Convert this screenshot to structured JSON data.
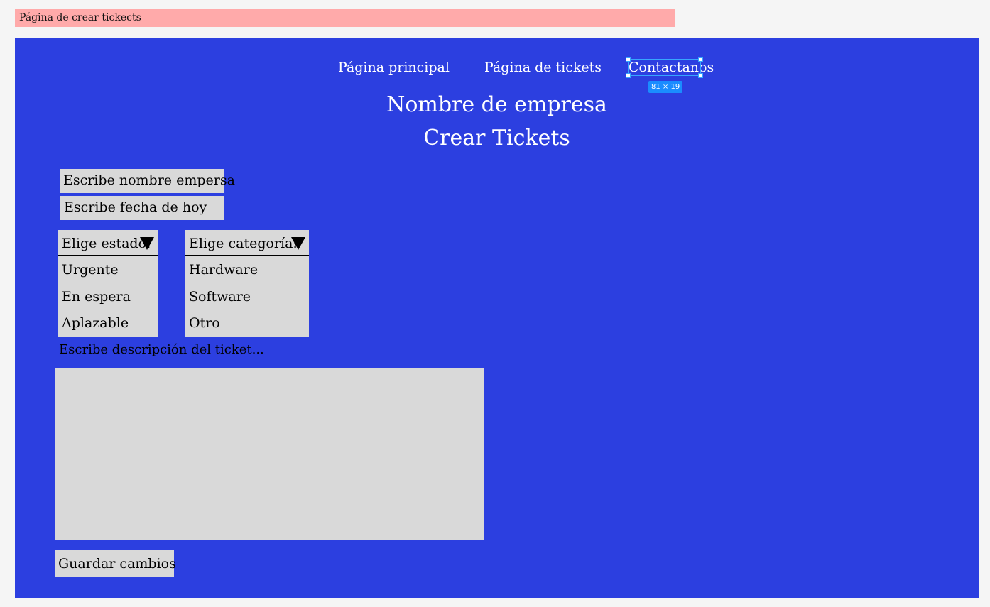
{
  "frame": {
    "label": "Página de crear tickects"
  },
  "nav": {
    "items": [
      {
        "label": "Página principal"
      },
      {
        "label": "Página de tickets"
      },
      {
        "label": "Contactanos"
      }
    ],
    "selection_size": "81 × 19"
  },
  "header": {
    "company": "Nombre de empresa",
    "title": "Crear Tickets"
  },
  "form": {
    "company_placeholder": "Escribe nombre empersa",
    "date_placeholder": "Escribe fecha de hoy",
    "estado": {
      "label": "Elige estado:",
      "options": [
        "Urgente",
        "En espera",
        "Aplazable"
      ]
    },
    "categoria": {
      "label": "Elige categoría:",
      "options": [
        "Hardware",
        "Software",
        "Otro"
      ]
    },
    "description_label": "Escribe descripción del ticket...",
    "save_label": "Guardar cambios"
  },
  "colors": {
    "canvas": "#2c3fe0",
    "frame_label_bg": "#ffaaaa",
    "field_bg": "#d9d9d9",
    "selection": "#37a5ff"
  },
  "icons": {
    "dropdown": "triangle-down-icon"
  }
}
